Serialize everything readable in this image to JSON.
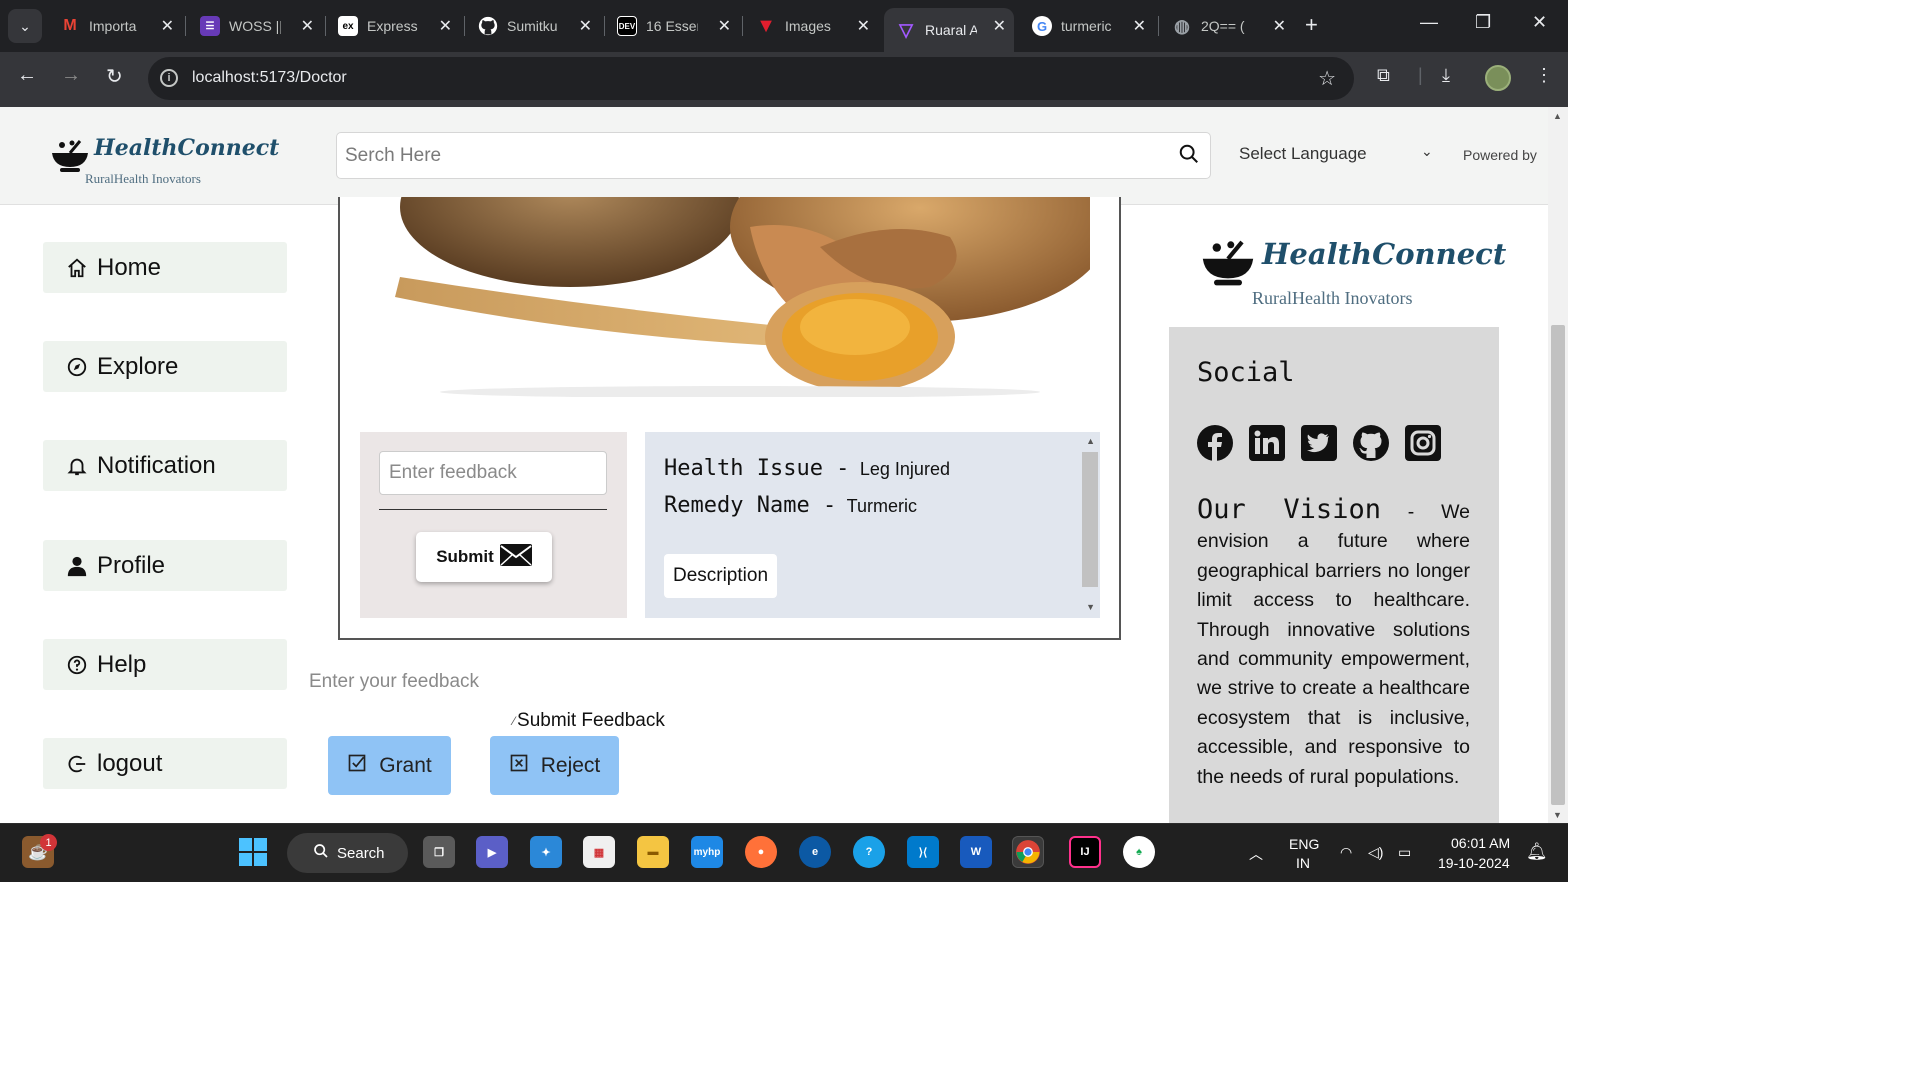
{
  "browser": {
    "tabs": [
      {
        "label": "Importa",
        "favicon": "gmail-icon",
        "color": "#ea4335"
      },
      {
        "label": "WOSS ||",
        "favicon": "forms-icon",
        "color": "#673ab7"
      },
      {
        "label": "Express",
        "favicon": "ex-icon",
        "color": "#ffffff"
      },
      {
        "label": "Sumitku",
        "favicon": "github-icon",
        "color": "#ffffff"
      },
      {
        "label": "16 Esser",
        "favicon": "dev-icon",
        "color": "#000000"
      },
      {
        "label": "Images",
        "favicon": "v-icon",
        "color": "#e21e2e"
      },
      {
        "label": "Ruaral A",
        "favicon": "vite-icon",
        "color": "#a259ff",
        "active": true
      },
      {
        "label": "turmeric",
        "favicon": "google-icon",
        "color": "#4285f4"
      },
      {
        "label": "2Q== (",
        "favicon": "globe-icon",
        "color": "#9aa0a6"
      }
    ],
    "url": "localhost:5173/Doctor"
  },
  "header": {
    "brand": "HealthConnect",
    "tagline": "RuralHealth Inovators",
    "search_placeholder": "Serch Here",
    "language": "Select Language",
    "powered_by": "Powered by"
  },
  "sidebar": {
    "items": [
      {
        "label": "Home",
        "icon": "home-icon"
      },
      {
        "label": "Explore",
        "icon": "compass-icon"
      },
      {
        "label": "Notification",
        "icon": "bell-icon"
      },
      {
        "label": "Profile",
        "icon": "user-icon"
      },
      {
        "label": "Help",
        "icon": "help-icon"
      },
      {
        "label": "logout",
        "icon": "logout-icon"
      }
    ]
  },
  "card": {
    "feedback_placeholder": "Enter feedback",
    "submit_label": "Submit",
    "health_issue_key": "Health Issue -",
    "health_issue_value": "Leg Injured",
    "remedy_key": "Remedy Name -",
    "remedy_value": "Turmeric",
    "description_label": "Description"
  },
  "feedback": {
    "placeholder": "Enter your feedback",
    "submit_label": "Submit Feedback",
    "grant_label": "Grant",
    "reject_label": "Reject"
  },
  "right_panel": {
    "brand": "HealthConnect",
    "tagline": "RuralHealth Inovators",
    "social_title": "Social",
    "social_icons": [
      "facebook-icon",
      "linkedin-icon",
      "twitter-icon",
      "github-icon",
      "instagram-icon"
    ],
    "vision_title": "Our Vision",
    "vision_text": " - We envision a future where geographical barriers no longer limit access to healthcare. Through innovative solutions and community empowerment, we strive to create a healthcare ecosystem that is inclusive, accessible, and responsive to the needs of rural populations."
  },
  "taskbar": {
    "search_label": "Search",
    "notification_count": "1",
    "lang_top": "ENG",
    "lang_bottom": "IN",
    "time": "06:01 AM",
    "date": "19-10-2024"
  },
  "colors": {
    "accent_button": "#8fc3f5",
    "brand": "#1f4f6b",
    "sidebar_bg": "#eef3ee"
  }
}
